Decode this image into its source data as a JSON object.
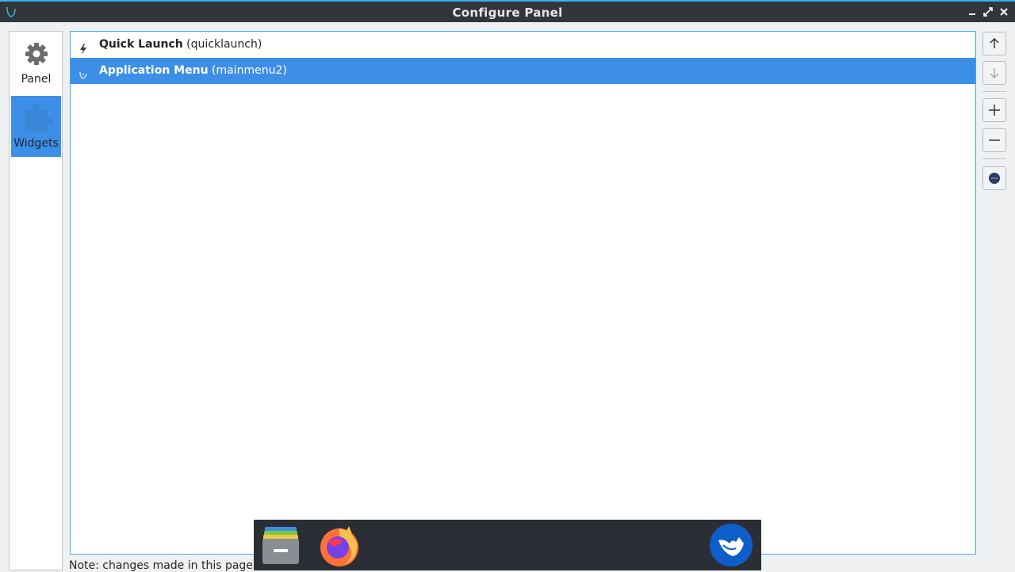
{
  "window": {
    "title": "Configure Panel"
  },
  "sidebar": {
    "items": [
      {
        "label": "Panel",
        "icon": "gear-icon",
        "selected": false
      },
      {
        "label": "Widgets",
        "icon": "puzzle-icon",
        "selected": true
      }
    ]
  },
  "widgets": {
    "rows": [
      {
        "name": "Quick Launch",
        "id": "(quicklaunch)",
        "icon": "lightning-icon",
        "selected": false
      },
      {
        "name": "Application Menu",
        "id": "(mainmenu2)",
        "icon": "menu-bird-icon",
        "selected": true
      }
    ]
  },
  "actions": {
    "move_up": "arrow-up-icon",
    "move_down": "arrow-down-icon",
    "add": "plus-icon",
    "remove": "minus-icon",
    "settings": "preferences-icon"
  },
  "note": "Note: changes made in this page ca",
  "dock": {
    "items": [
      "file-manager-icon",
      "firefox-icon",
      "distro-menu-icon"
    ]
  },
  "colors": {
    "accent": "#3d8ee6",
    "titlebar": "#31363b",
    "focus_border": "#3daee9",
    "dock": "#2b2e35"
  }
}
